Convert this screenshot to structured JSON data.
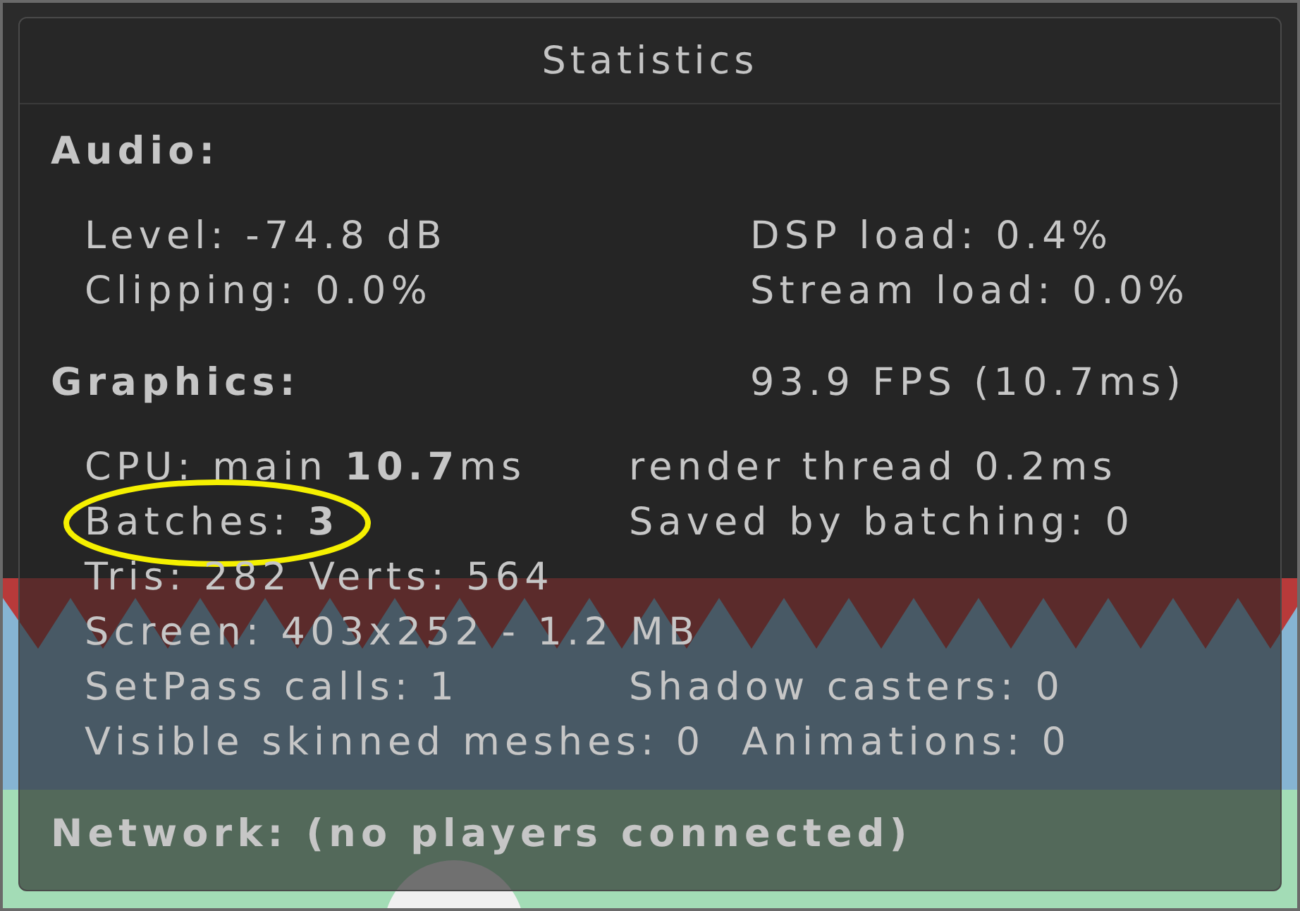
{
  "window": {
    "title": "Statistics"
  },
  "audio": {
    "heading": "Audio:",
    "rows": [
      {
        "left": "Level: -74.8 dB",
        "right": "DSP load: 0.4%"
      },
      {
        "left": "Clipping: 0.0%",
        "right": "Stream load: 0.0%"
      }
    ]
  },
  "graphics": {
    "heading": "Graphics:",
    "fps": "93.9 FPS (10.7ms)",
    "rows": [
      {
        "left": "CPU: main **10.7**ms",
        "right": "render thread 0.2ms",
        "highlighted": false
      },
      {
        "left": "Batches: **3**",
        "right": "Saved by batching: 0",
        "highlighted": true
      },
      {
        "left": "Tris: 282 Verts: 564",
        "highlighted": false
      },
      {
        "left": "Screen: 403x252 - 1.2 MB",
        "highlighted": false
      },
      {
        "left": "SetPass calls: 1",
        "right": "Shadow casters: 0",
        "highlighted": false
      },
      {
        "left": "Visible skinned meshes: 0",
        "right": "Animations: 0",
        "highlighted": false
      }
    ]
  },
  "network": {
    "heading": "Network: (no players connected)"
  }
}
